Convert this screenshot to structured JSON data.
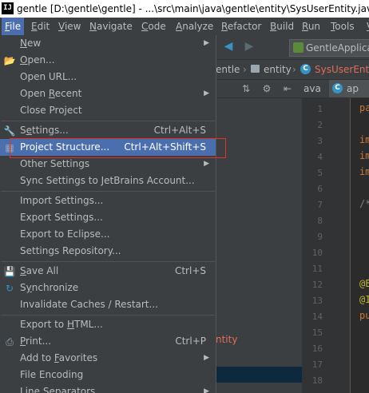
{
  "window": {
    "title": "gentle [D:\\gentle\\gentle] - ...\\src\\main\\java\\gentle\\entity\\SysUserEntity.java [",
    "app_icon": "IJ"
  },
  "menubar": {
    "items": [
      {
        "label": "File",
        "active": true
      },
      {
        "label": "Edit"
      },
      {
        "label": "View"
      },
      {
        "label": "Navigate"
      },
      {
        "label": "Code"
      },
      {
        "label": "Analyze"
      },
      {
        "label": "Refactor"
      },
      {
        "label": "Build"
      },
      {
        "label": "Run"
      },
      {
        "label": "Tools"
      },
      {
        "label": "V"
      }
    ]
  },
  "toolbar": {
    "run_config": "GentleApplica",
    "back_icon": "arrow-left-icon",
    "forward_icon": "arrow-right-icon"
  },
  "breadcrumb": {
    "items": [
      "entle",
      "entity",
      "SysUserEnti"
    ]
  },
  "project_panel": {
    "entity_label": "ntity"
  },
  "editor": {
    "tabs": [
      "ava",
      "ap"
    ],
    "line_numbers": [
      "1",
      "2",
      "3",
      "4",
      "5",
      "6",
      "7",
      "8",
      "9",
      "10",
      "11",
      "12",
      "13",
      "14",
      "15",
      "16",
      "17",
      "18"
    ],
    "code_lines": [
      {
        "text": "pa",
        "cls": "kw"
      },
      {
        "text": "",
        "cls": ""
      },
      {
        "text": "im",
        "cls": "kw"
      },
      {
        "text": "im",
        "cls": "kw"
      },
      {
        "text": "im",
        "cls": "kw"
      },
      {
        "text": "",
        "cls": ""
      },
      {
        "text": "/*",
        "cls": "cm"
      },
      {
        "text": "",
        "cls": ""
      },
      {
        "text": "",
        "cls": ""
      },
      {
        "text": "",
        "cls": ""
      },
      {
        "text": "",
        "cls": ""
      },
      {
        "text": "@E",
        "cls": "ann"
      },
      {
        "text": "@I",
        "cls": "ann"
      },
      {
        "text": "pu",
        "cls": "kw"
      },
      {
        "text": "",
        "cls": ""
      },
      {
        "text": "",
        "cls": ""
      },
      {
        "text": "",
        "cls": ""
      },
      {
        "text": "",
        "cls": ""
      }
    ]
  },
  "file_menu": {
    "items": [
      {
        "label": "New",
        "ul": 0,
        "submenu": true
      },
      {
        "label": "Open...",
        "ul": 0,
        "icon": "folder-open-icon"
      },
      {
        "label": "Open URL..."
      },
      {
        "label": "Open Recent",
        "ul": 5,
        "submenu": true
      },
      {
        "label": "Close Project"
      },
      {
        "sep": true
      },
      {
        "label": "Settings...",
        "ul": 1,
        "shortcut": "Ctrl+Alt+S",
        "icon": "wrench-icon"
      },
      {
        "label": "Project Structure...",
        "shortcut": "Ctrl+Alt+Shift+S",
        "icon": "project-structure-icon",
        "highlight": true
      },
      {
        "label": "Other Settings",
        "submenu": true
      },
      {
        "label": "Sync Settings to JetBrains Account..."
      },
      {
        "sep": true
      },
      {
        "label": "Import Settings..."
      },
      {
        "label": "Export Settings..."
      },
      {
        "label": "Export to Eclipse..."
      },
      {
        "label": "Settings Repository..."
      },
      {
        "sep": true
      },
      {
        "label": "Save All",
        "ul": 0,
        "shortcut": "Ctrl+S",
        "icon": "save-all-icon"
      },
      {
        "label": "Synchronize",
        "ul": 1,
        "icon": "sync-icon"
      },
      {
        "label": "Invalidate Caches / Restart..."
      },
      {
        "sep": true
      },
      {
        "label": "Export to HTML...",
        "ul": 10
      },
      {
        "label": "Print...",
        "ul": 0,
        "shortcut": "Ctrl+P",
        "icon": "print-icon"
      },
      {
        "label": "Add to Favorites",
        "ul": 7,
        "submenu": true
      },
      {
        "label": "File Encoding"
      },
      {
        "label": "Line Separators",
        "submenu": true
      }
    ]
  }
}
